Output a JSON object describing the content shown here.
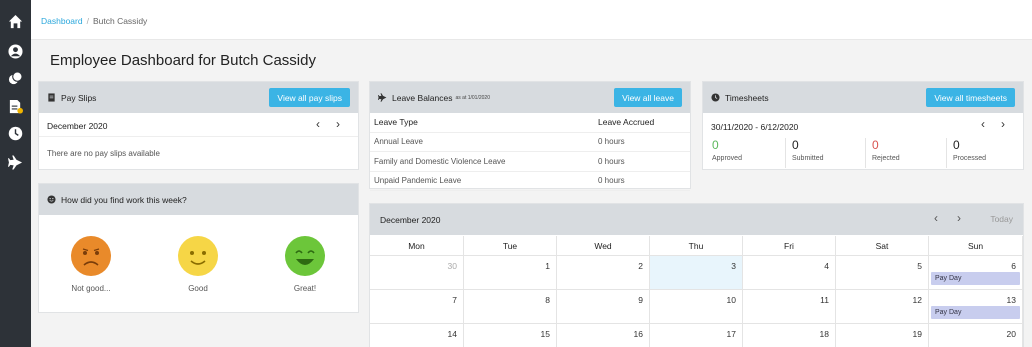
{
  "breadcrumb": {
    "home": "Dashboard",
    "current": "Butch Cassidy"
  },
  "page": {
    "title": "Employee Dashboard for Butch Cassidy"
  },
  "sidebar": {
    "icons": [
      "home-icon",
      "user-icon",
      "coins-icon",
      "document-icon",
      "clock-icon",
      "plane-icon"
    ]
  },
  "payslips": {
    "title": "Pay Slips",
    "button": "View all pay slips",
    "month": "December 2020",
    "empty": "There are no pay slips available"
  },
  "leave": {
    "title": "Leave Balances",
    "as_at": "as at 1/01/2020",
    "button": "View all leave",
    "col_type": "Leave Type",
    "col_accrued": "Leave Accrued",
    "rows": [
      {
        "type": "Annual Leave",
        "accrued": "0 hours"
      },
      {
        "type": "Family and Domestic Violence Leave",
        "accrued": "0 hours"
      },
      {
        "type": "Unpaid Pandemic Leave",
        "accrued": "0 hours"
      }
    ]
  },
  "timesheets": {
    "title": "Timesheets",
    "button": "View all timesheets",
    "period": "30/11/2020 - 6/12/2020",
    "stats": [
      {
        "value": "0",
        "label": "Approved",
        "color": "#5cb85c"
      },
      {
        "value": "0",
        "label": "Submitted",
        "color": "#222222"
      },
      {
        "value": "0",
        "label": "Rejected",
        "color": "#d9534f"
      },
      {
        "value": "0",
        "label": "Processed",
        "color": "#222222"
      }
    ]
  },
  "feedback": {
    "title": "How did you find work this week?",
    "options": [
      {
        "label": "Not good...",
        "color": "#e98a2a"
      },
      {
        "label": "Good",
        "color": "#f6d646"
      },
      {
        "label": "Great!",
        "color": "#6cc63a"
      }
    ]
  },
  "calendar": {
    "month": "December 2020",
    "today_label": "Today",
    "days": [
      "Mon",
      "Tue",
      "Wed",
      "Thu",
      "Fri",
      "Sat",
      "Sun"
    ],
    "weeks": [
      [
        "30",
        "1",
        "2",
        "3",
        "4",
        "5",
        "6"
      ],
      [
        "7",
        "8",
        "9",
        "10",
        "11",
        "12",
        "13"
      ],
      [
        "14",
        "15",
        "16",
        "17",
        "18",
        "19",
        "20"
      ]
    ],
    "event_label": "Pay Day"
  }
}
